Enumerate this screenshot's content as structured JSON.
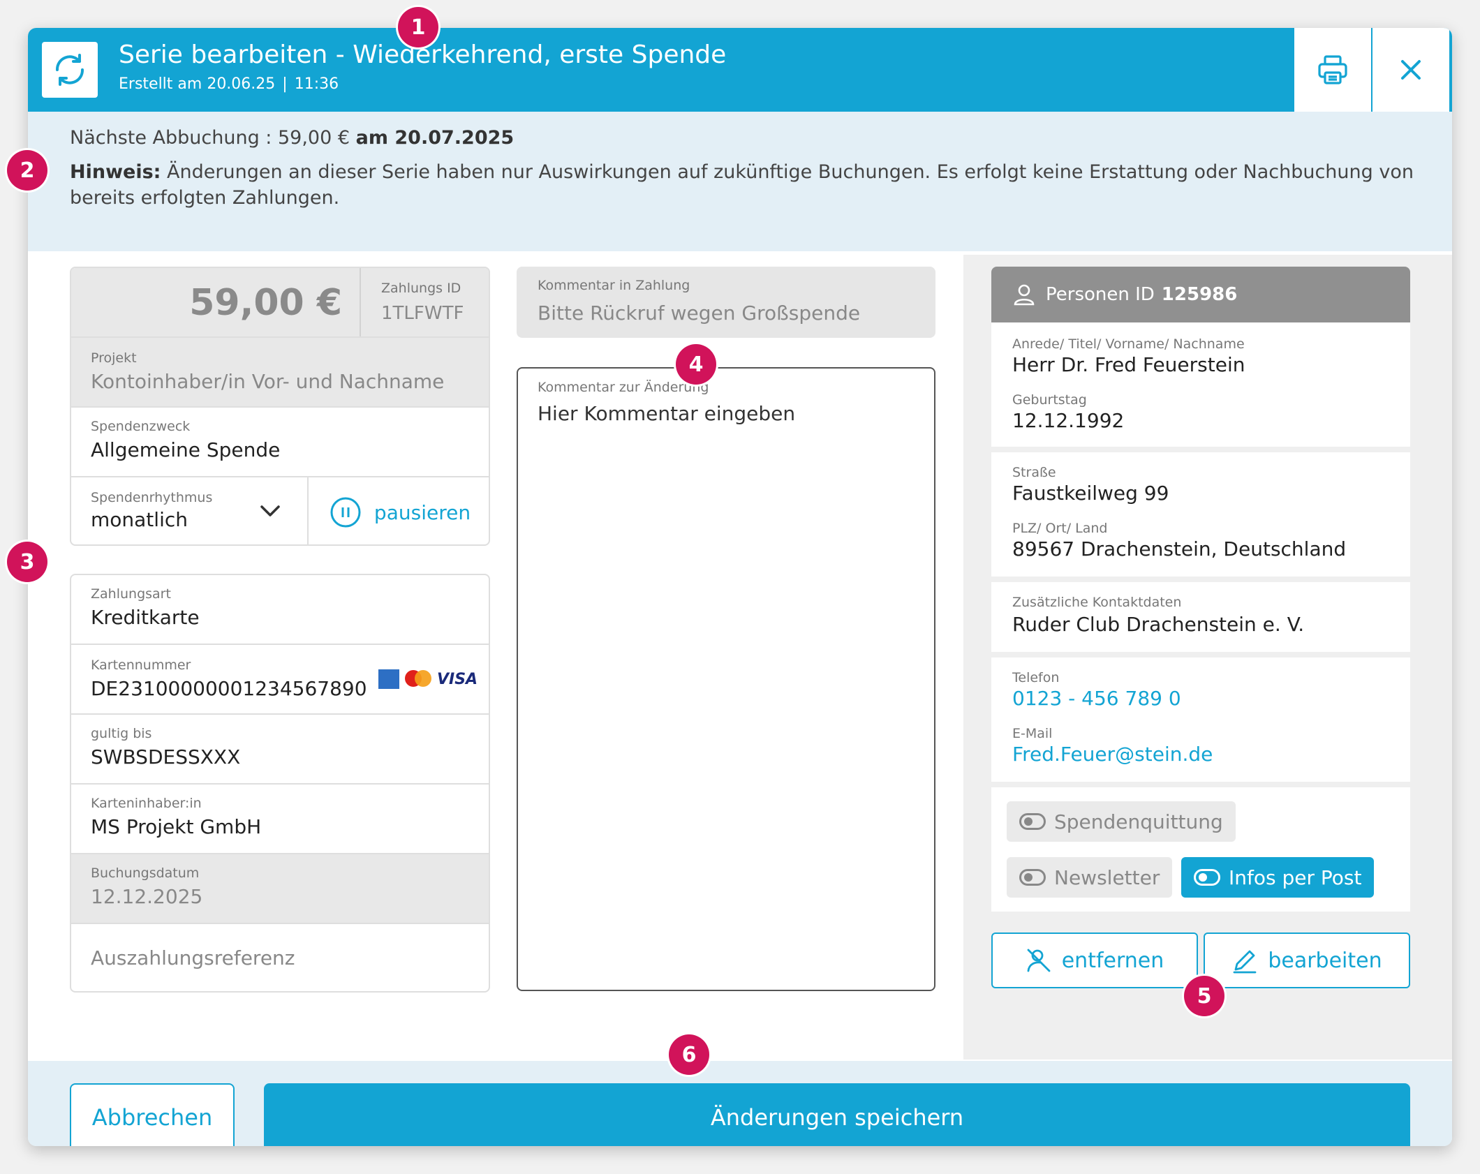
{
  "header": {
    "title": "Serie bearbeiten - Wiederkehrend, erste Spende",
    "created_label": "Erstellt am 20.06.25",
    "separator": "|",
    "created_time": "11:36"
  },
  "info": {
    "next_label": "Nächste Abbuchung : 59,00 €",
    "next_date": "am 20.07.2025",
    "hint_label": "Hinweis:",
    "hint_text": "Änderungen an dieser Serie haben nur Auswirkungen auf zukünftige Buchungen. Es erfolgt keine Erstattung oder Nachbuchung von bereits erfolgten Zahlungen."
  },
  "payment": {
    "amount": "59,00 €",
    "id_label": "Zahlungs ID",
    "id_value": "1TLFWTF",
    "project_label": "Projekt",
    "project_placeholder": "Kontoinhaber/in Vor- und Nachname",
    "purpose_label": "Spendenzweck",
    "purpose_value": "Allgemeine Spende",
    "rhythm_label": "Spendenrhythmus",
    "rhythm_value": "monatlich",
    "pause_label": "pausieren"
  },
  "method": {
    "type_label": "Zahlungsart",
    "type_value": "Kreditkarte",
    "card_label": "Kartennummer",
    "card_value": "DE23100000001234567890",
    "valid_label": "gultig bis",
    "valid_value": "SWBSDESSXXX",
    "holder_label": "Karteninhaber:in",
    "holder_value": "MS Projekt GmbH",
    "booking_label": "Buchungsdatum",
    "booking_value": "12.12.2025",
    "reference_placeholder": "Auszahlungsreferenz",
    "visa_text": "VISA"
  },
  "comments": {
    "payment_label": "Kommentar in Zahlung",
    "payment_value": "Bitte Rückruf wegen Großspende",
    "change_label": "Kommentar zur Änderung",
    "change_placeholder": "Hier Kommentar eingeben"
  },
  "person": {
    "id_label": "Personen ID",
    "id_value": "125986",
    "name_label": "Anrede/ Titel/ Vorname/ Nachname",
    "name_value": "Herr Dr. Fred Feuerstein",
    "birthday_label": "Geburtstag",
    "birthday_value": "12.12.1992",
    "street_label": "Straße",
    "street_value": "Faustkeilweg 99",
    "city_label": "PLZ/ Ort/ Land",
    "city_value": "89567 Drachenstein, Deutschland",
    "extra_label": "Zusätzliche Kontaktdaten",
    "extra_value": "Ruder Club Drachenstein e. V.",
    "phone_label": "Telefon",
    "phone_value": "0123 - 456 789 0",
    "email_label": "E-Mail",
    "email_value": "Fred.Feuer@stein.de",
    "toggle_receipt": "Spendenquittung",
    "toggle_newsletter": "Newsletter",
    "toggle_post": "Infos per Post",
    "remove_label": "entfernen",
    "edit_label": "bearbeiten"
  },
  "footer": {
    "cancel_label": "Abbrechen",
    "save_label": "Änderungen speichern"
  },
  "markers": [
    "1",
    "2",
    "3",
    "4",
    "5",
    "6"
  ],
  "colors": {
    "accent": "#13a4d3",
    "marker": "#d1135a",
    "info_band": "#e3eff6"
  }
}
